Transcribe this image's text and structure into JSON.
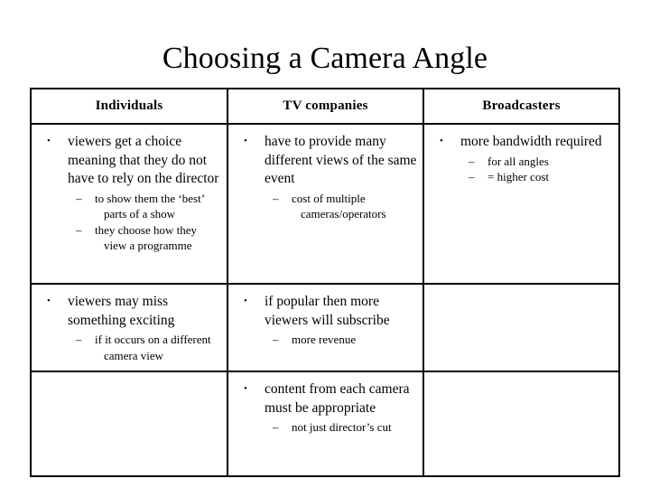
{
  "slide": {
    "title": "Choosing a Camera Angle"
  },
  "table": {
    "headers": [
      {
        "label": "Individuals"
      },
      {
        "label": "TV companies"
      },
      {
        "label": "Broadcasters"
      }
    ],
    "rows": [
      {
        "cells": [
          {
            "bullets": [
              {
                "text": "viewers get a choice meaning that they do not have to rely on the director",
                "sub": [
                  "to show them the ‘best’ parts of a show",
                  "they choose how they view a programme"
                ]
              }
            ]
          },
          {
            "bullets": [
              {
                "text": "have to provide many different views of the same event",
                "sub": [
                  "cost of multiple cameras/operators"
                ]
              }
            ]
          },
          {
            "bullets": [
              {
                "text": "more bandwidth required",
                "sub": [
                  "for all angles",
                  "= higher cost"
                ]
              }
            ]
          }
        ]
      },
      {
        "cells": [
          {
            "bullets": [
              {
                "text": "viewers may miss something exciting",
                "sub": [
                  "if it occurs on a different camera view"
                ]
              }
            ]
          },
          {
            "bullets": [
              {
                "text": "if popular then more viewers will subscribe",
                "sub": [
                  "more revenue"
                ]
              }
            ]
          },
          {
            "bullets": []
          }
        ]
      },
      {
        "cells": [
          {
            "bullets": []
          },
          {
            "bullets": [
              {
                "text": "content from each camera must be appropriate",
                "sub": [
                  "not just director’s cut"
                ]
              }
            ]
          },
          {
            "bullets": []
          }
        ]
      }
    ]
  },
  "colors": {
    "background": "#ffffff",
    "text": "#000000",
    "border": "#000000"
  }
}
